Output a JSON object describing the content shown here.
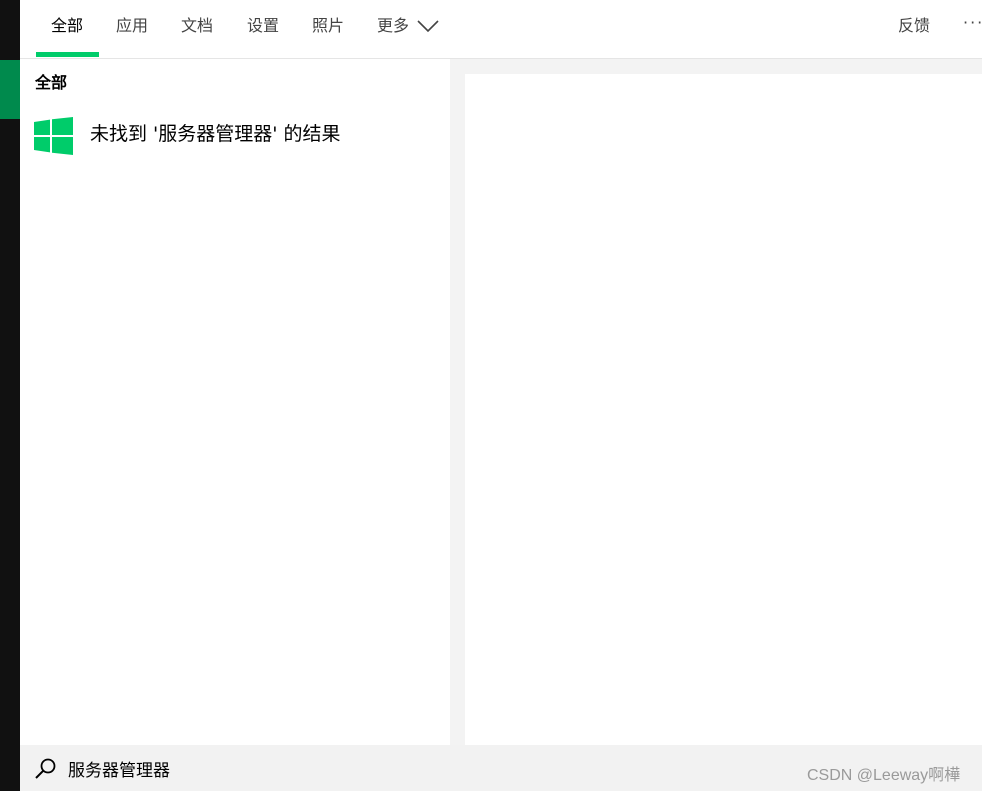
{
  "tabs": [
    {
      "label": "全部",
      "active": true
    },
    {
      "label": "应用"
    },
    {
      "label": "文档"
    },
    {
      "label": "设置"
    },
    {
      "label": "照片"
    },
    {
      "label": "更多"
    }
  ],
  "header": {
    "feedback_label": "反馈",
    "more_options_label": "···"
  },
  "results": {
    "section_heading": "全部",
    "no_result_text": "未找到 '服务器管理器' 的结果",
    "icon": "windows-logo-icon"
  },
  "search": {
    "value": "服务器管理器",
    "icon": "search-icon"
  },
  "watermark": "CSDN @Leeway啊樺",
  "colors": {
    "accent": "#00cc6a",
    "left_accent": "#008a4d",
    "strip": "#111111",
    "search_bg": "#f2f2f2"
  }
}
